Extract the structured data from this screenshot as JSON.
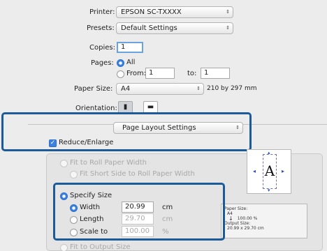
{
  "printer": {
    "label": "Printer:",
    "value": "EPSON SC-TXXXX"
  },
  "presets": {
    "label": "Presets:",
    "value": "Default Settings"
  },
  "copies": {
    "label": "Copies:",
    "value": "1"
  },
  "pages": {
    "label": "Pages:",
    "all_label": "All",
    "from_label": "From:",
    "from_value": "1",
    "to_label": "to:",
    "to_value": "1",
    "selected": "All"
  },
  "paper_size": {
    "label": "Paper Size:",
    "value": "A4",
    "dimensions": "210 by 297 mm"
  },
  "orientation": {
    "label": "Orientation:",
    "selected": "portrait"
  },
  "panel_menu": {
    "value": "Page Layout Settings"
  },
  "reduce_enlarge": {
    "label": "Reduce/Enlarge",
    "checked": true
  },
  "fit_to_roll": {
    "label": "Fit to Roll Paper Width",
    "sub_option": "Fit Short Side to Roll Paper Width"
  },
  "specify_size": {
    "label": "Specify Size",
    "selected": true,
    "width_label": "Width",
    "width_value": "20.99",
    "width_unit": "cm",
    "length_label": "Length",
    "length_value": "29.70",
    "length_unit": "cm",
    "scale_label": "Scale to",
    "scale_value": "100.00",
    "scale_unit": "%",
    "selected_dimension": "Width"
  },
  "fit_output": {
    "label": "Fit to Output Size"
  },
  "info": {
    "paper_size_label": "Paper Size:",
    "paper_size_value": "A4",
    "scale_value": "100.00 %",
    "output_size_label": "Output Size:",
    "output_size_value": "20.99 x 29.70 cm"
  },
  "preview": {
    "letter": "A"
  },
  "colors": {
    "accent": "#3b82e0",
    "highlight_border": "#1d5a9a"
  }
}
